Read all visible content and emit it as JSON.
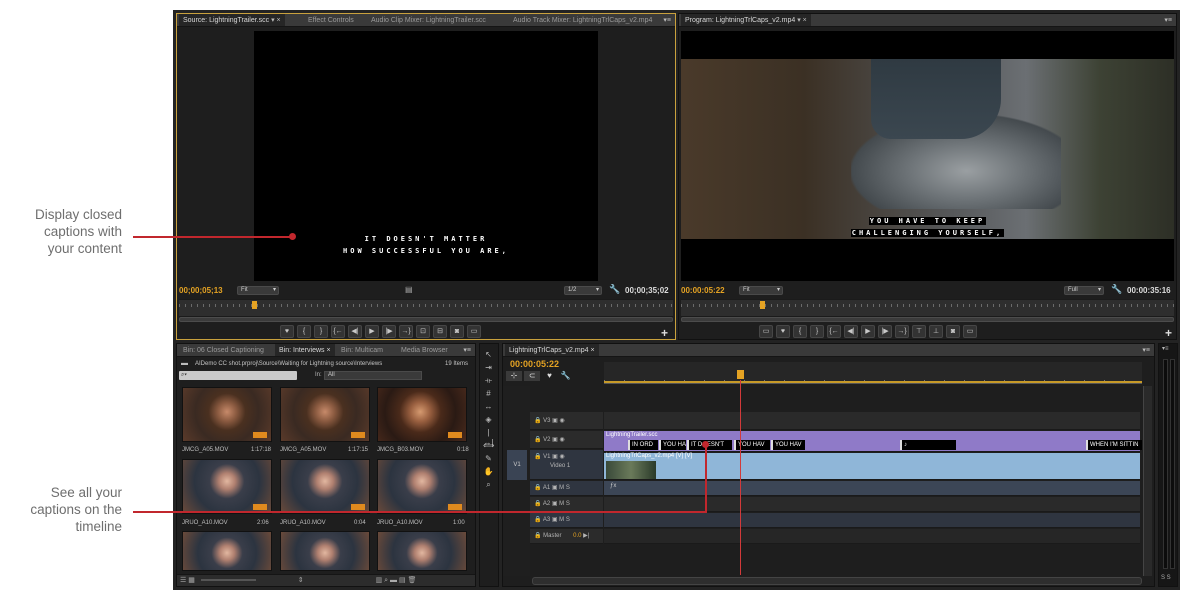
{
  "annotations": {
    "top": [
      "Display closed",
      "captions with",
      "your content"
    ],
    "bottom": [
      "See all your",
      "captions on the",
      "timeline"
    ]
  },
  "source_monitor": {
    "tabs": [
      "Source: LightningTrailer.scc",
      "Effect Controls",
      "Audio Clip Mixer: LightningTrailer.scc",
      "Audio Track Mixer: LightningTrlCaps_v2.mp4"
    ],
    "caption_lines": [
      "IT DOESN'T MATTER",
      "HOW SUCCESSFUL YOU ARE,"
    ],
    "timecode": "00;00;05;13",
    "fit": "Fit",
    "resolution": "1/2",
    "duration": "00;00;35;02"
  },
  "program_monitor": {
    "tab": "Program: LightningTrlCaps_v2.mp4",
    "caption_lines": [
      "YOU HAVE TO KEEP",
      "CHALLENGING YOURSELF,"
    ],
    "timecode": "00:00:05:22",
    "fit": "Fit",
    "resolution": "Full",
    "duration": "00:00:35:16"
  },
  "project": {
    "tabs": [
      "Bin: 06 Closed Captioning",
      "Bin: Interviews",
      "Bin: Multicam",
      "Media Browser"
    ],
    "path": "AIDemo CC shot.prproj\\Source\\Waiting for Lightning source\\Interviews",
    "count": "19 Items",
    "in_label": "In:",
    "in_value": "All",
    "clips": [
      {
        "name": "JMCG_A05.MOV",
        "dur": "1:17:18"
      },
      {
        "name": "JMCG_A05.MOV",
        "dur": "1:17:15"
      },
      {
        "name": "JMCG_B03.MOV",
        "dur": "0:18"
      },
      {
        "name": "JRUO_A10.MOV",
        "dur": "2:06"
      },
      {
        "name": "JRUO_A10.MOV",
        "dur": "0:04"
      },
      {
        "name": "JRUO_A10.MOV",
        "dur": "1:00"
      }
    ]
  },
  "timeline": {
    "tab": "LightningTrlCaps_v2.mp4",
    "timecode": "00:00:05:22",
    "tracks": {
      "v3": "V3",
      "v2": "V2",
      "v1": "V1",
      "v1_src": "V1",
      "video1": "Video 1",
      "a1": "A1",
      "a2": "A2",
      "a3": "A3",
      "master": "Master",
      "master_val": "0.0",
      "m": "M",
      "s": "S"
    },
    "caption_clip_name": "LightningTrailer.scc",
    "video_clip_name": "LightningTrlCaps_v2.mp4 [V] [V]",
    "captions": [
      "IN ORD",
      "YOU HA",
      "IT DOESN'T",
      "YOU HAV",
      "YOU HAV",
      "♪",
      "WHEN I'M SITTIN"
    ]
  },
  "colors": {
    "timecode": "#e5a323",
    "caption_track": "#8f7ac8",
    "video_track": "#8fb6d8",
    "annotation_line": "#c1272d"
  }
}
